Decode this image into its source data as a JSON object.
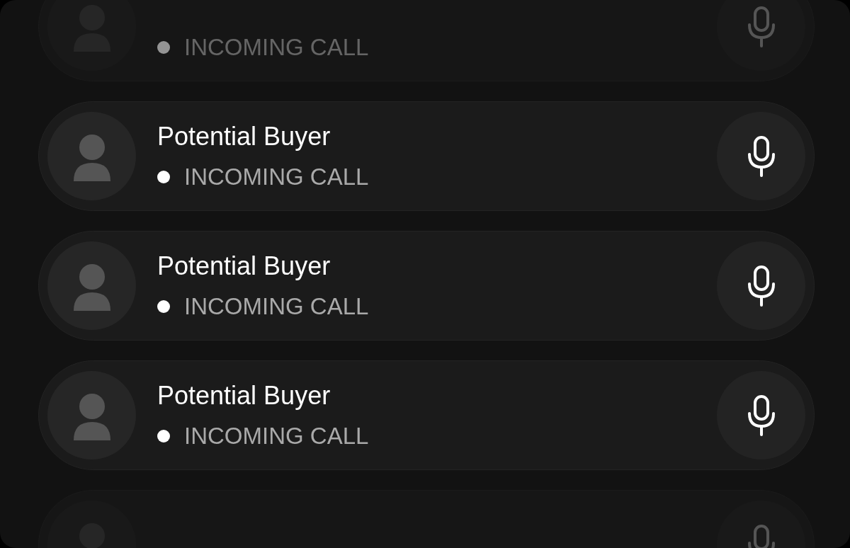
{
  "calls": [
    {
      "status": "INCOMING CALL",
      "dimmed": true
    },
    {
      "name": "Potential Buyer",
      "status": "INCOMING CALL",
      "dimmed": false
    },
    {
      "name": "Potential Buyer",
      "status": "INCOMING CALL",
      "dimmed": false
    },
    {
      "name": "Potential Buyer",
      "status": "INCOMING CALL",
      "dimmed": false
    },
    {
      "dimmed": true
    }
  ]
}
